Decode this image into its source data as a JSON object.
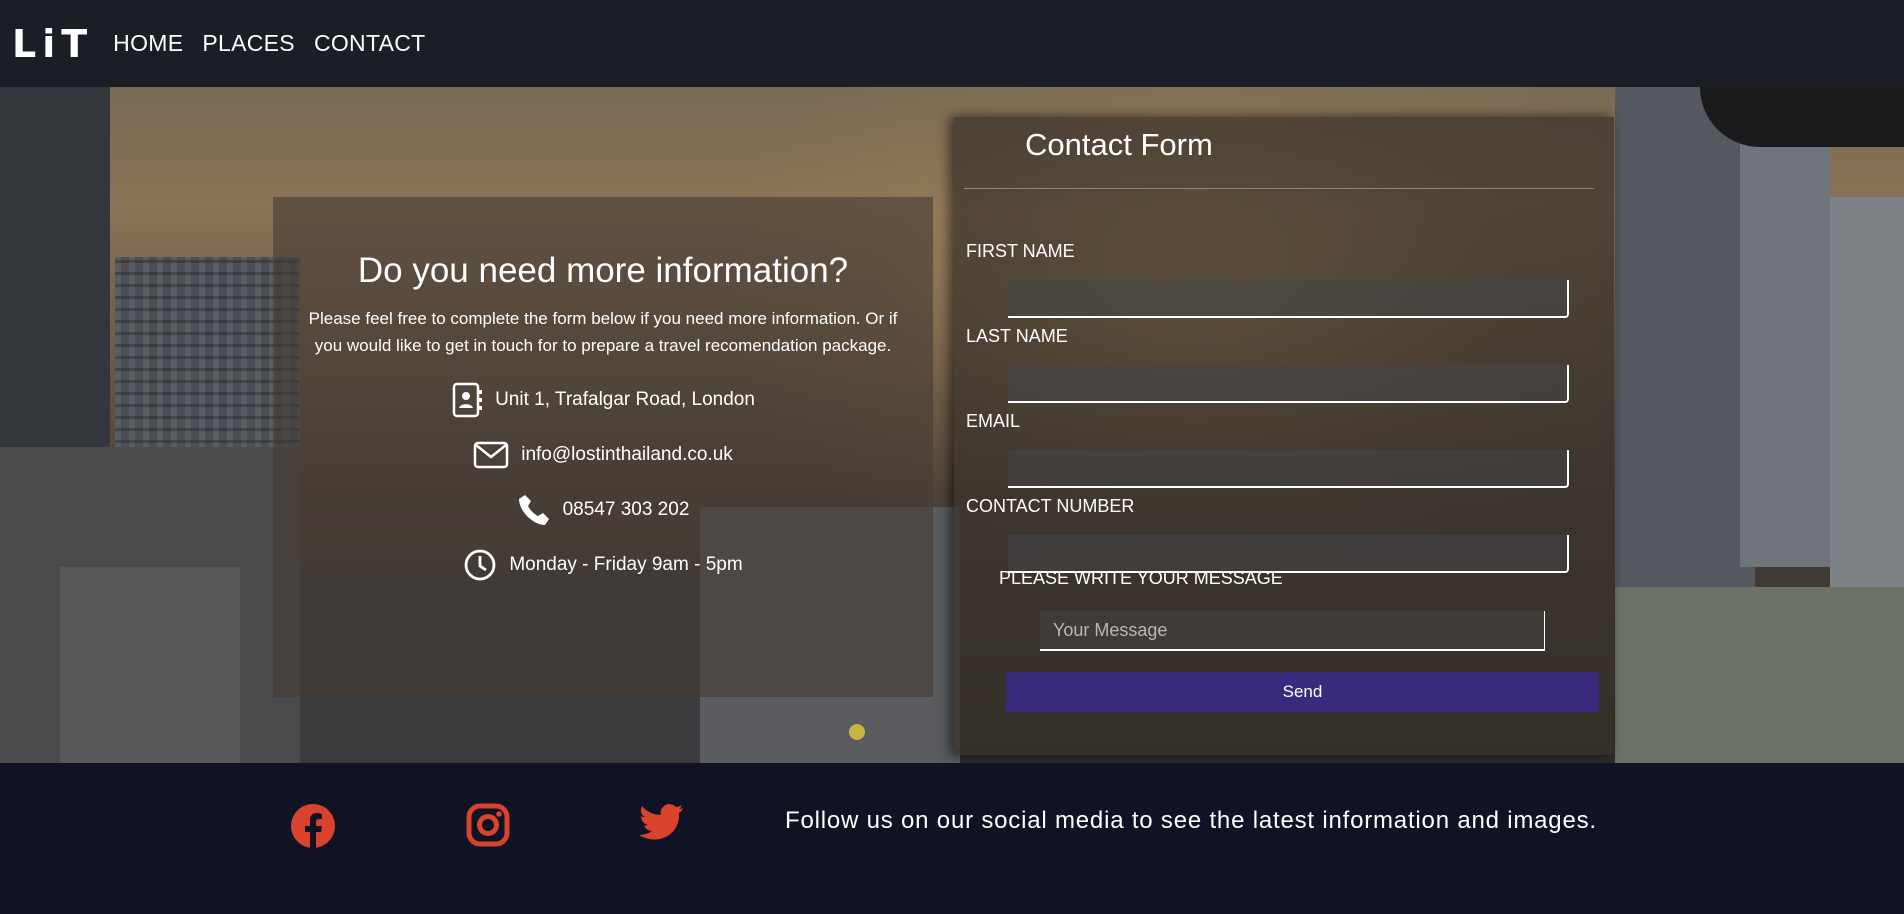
{
  "brand": {
    "logo": "LiT"
  },
  "nav": {
    "items": [
      {
        "label": "HOME"
      },
      {
        "label": "PLACES"
      },
      {
        "label": "CONTACT"
      }
    ]
  },
  "info": {
    "title": "Do you need more information?",
    "description_line1": "Please feel free to complete the form below if you need more information. Or if",
    "description_line2": "you would like to get in touch for to prepare a travel recomendation package.",
    "address": "Unit 1, Trafalgar Road, London",
    "email": "info@lostinthailand.co.uk",
    "phone": "08547 303 202",
    "hours": "Monday - Friday 9am - 5pm",
    "icons": [
      "contact-book-icon",
      "envelope-icon",
      "phone-icon",
      "clock-icon"
    ]
  },
  "form": {
    "title": "Contact Form",
    "first_name_label": "FIRST NAME",
    "last_name_label": "LAST NAME",
    "email_label": "EMAIL",
    "contact_number_label": "CONTACT NUMBER",
    "message_label": "PLEASE WRITE YOUR MESSAGE",
    "message_placeholder": "Your Message",
    "send_label": "Send",
    "send_color": "#3a2a7e"
  },
  "footer": {
    "text": "Follow us on our social media to see the latest information and images.",
    "social_icons": [
      "facebook-icon",
      "instagram-icon",
      "twitter-icon"
    ],
    "icon_color": "#d9432e"
  }
}
